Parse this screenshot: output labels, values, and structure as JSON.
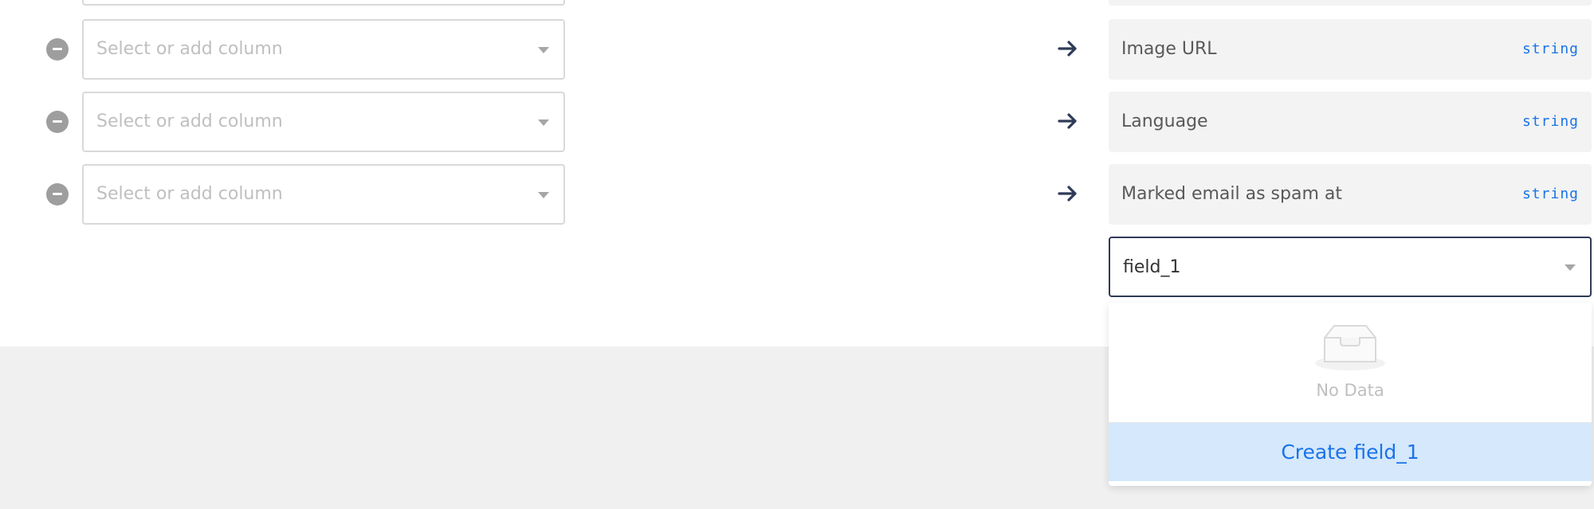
{
  "mapping": {
    "placeholder": "Select or add column",
    "rows": [
      {
        "target": "Image URL",
        "type": "string"
      },
      {
        "target": "Language",
        "type": "string"
      },
      {
        "target": "Marked email as spam at",
        "type": "string"
      }
    ]
  },
  "new_field": {
    "value": "field_1"
  },
  "dropdown": {
    "empty_text": "No Data",
    "create_label": "Create field_1"
  },
  "colors": {
    "accent": "#1a73e8",
    "option_highlight": "#d5e8fc",
    "arrow": "#2f3b57"
  }
}
